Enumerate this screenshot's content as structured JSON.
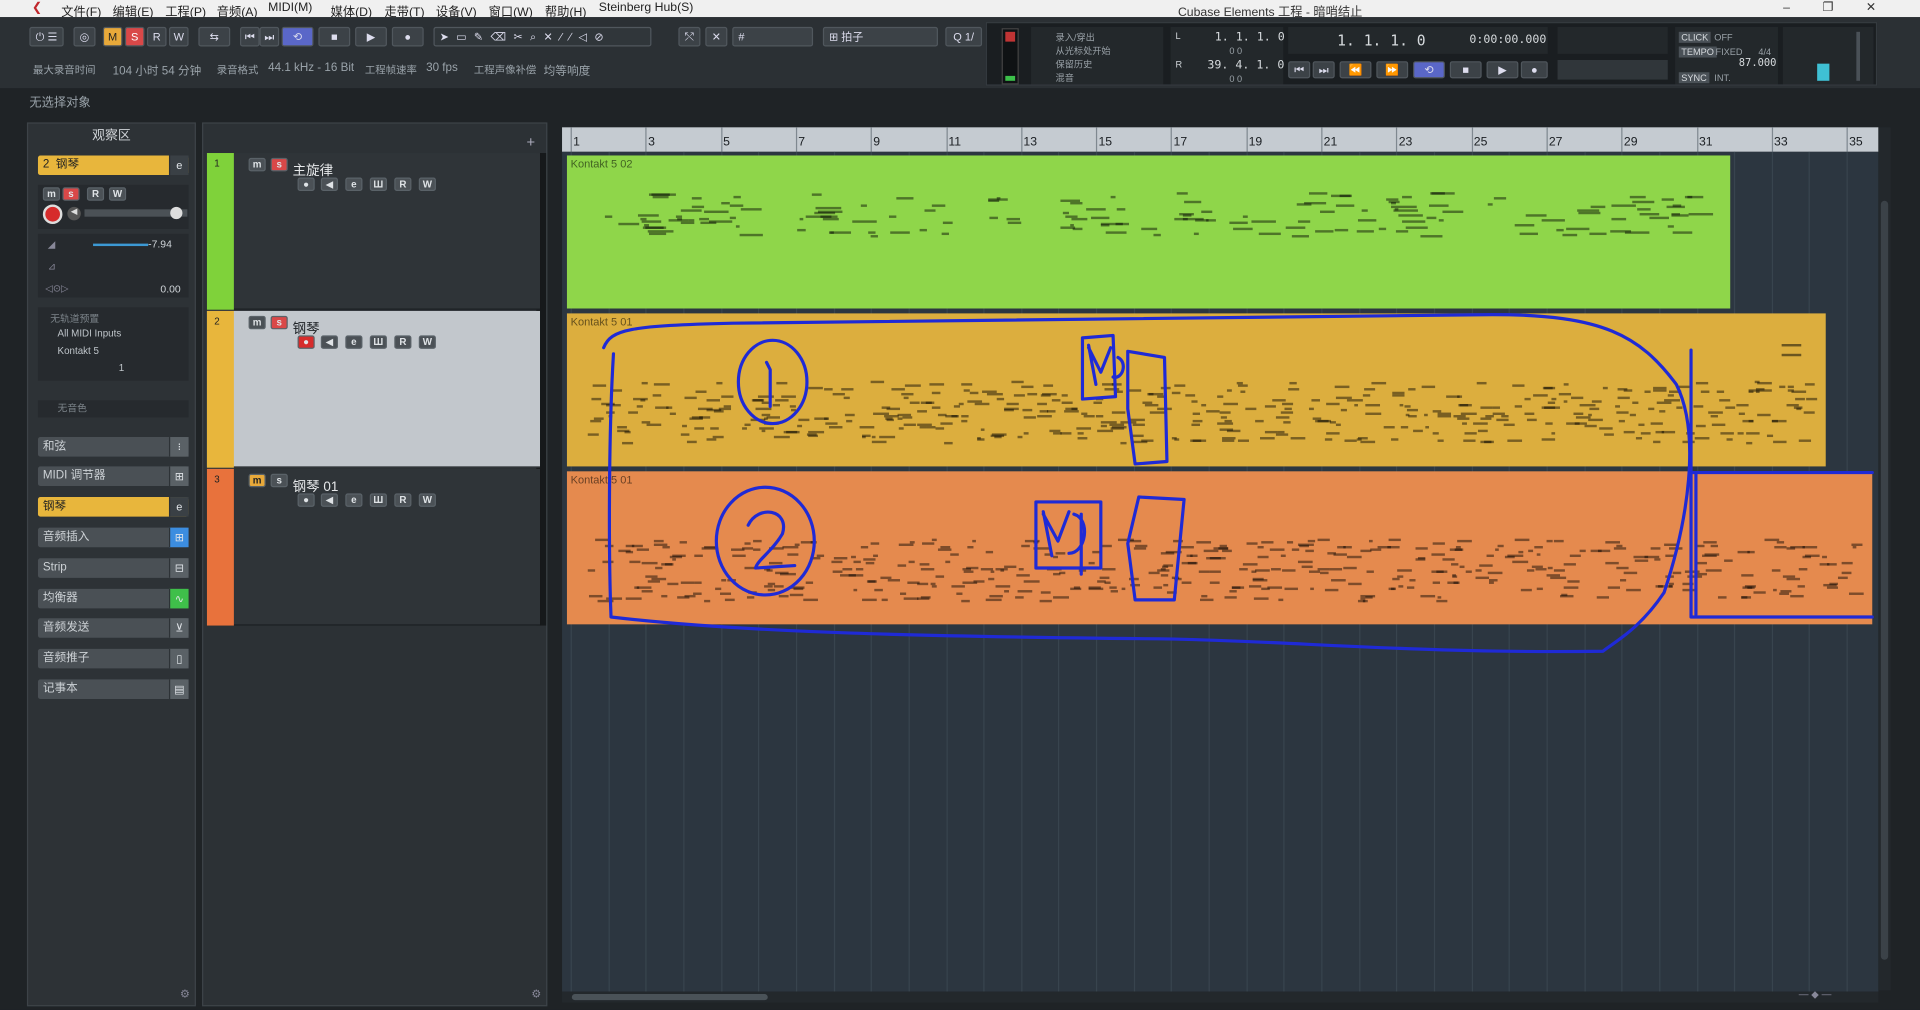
{
  "menu": {
    "items": [
      "文件(F)",
      "编辑(E)",
      "工程(P)",
      "音频(A)",
      "MIDI(M)",
      "媒体(D)",
      "走带(T)",
      "设备(V)",
      "窗口(W)",
      "帮助(H)",
      "Steinberg Hub(S)"
    ],
    "title": "Cubase Elements 工程 - 暗哨结止"
  },
  "toolbar": {
    "m_label": "M",
    "s_label": "S",
    "r_label": "R",
    "w_label": "W",
    "snap_type_label": "拍子",
    "info": {
      "max_record_label": "最大录音时间",
      "max_record_value": "104 小时 54 分钟",
      "format_label": "录音格式",
      "format_value": "44.1 kHz - 16 Bit",
      "fps_label": "工程帧速率",
      "fps_value": "30 fps",
      "pan_label": "工程声像补偿",
      "pan_value": "均等响度"
    }
  },
  "transport": {
    "history_items": [
      "录入/穿出",
      "从光标处开始",
      "保留历史",
      "混音"
    ],
    "left_locator": "1. 1. 1.   0",
    "left_locator_small": "0    0",
    "right_locator": "39. 4. 1.   0",
    "right_locator_small": "0    0",
    "position_bars": "1.  1.  1.    0",
    "position_time": "0:00:00.000",
    "click_label": "CLICK",
    "click_value": "OFF",
    "tempo_label": "TEMPO",
    "tempo_mode": "FIXED",
    "signature": "4/4",
    "tempo_value": "87.000",
    "sync_label": "SYNC",
    "sync_value": "INT."
  },
  "status": {
    "no_selection": "无选择对象"
  },
  "inspector": {
    "title": "观察区",
    "track_no": "2",
    "track_name": "钢琴",
    "volume_value": "-7.94",
    "pan_value": "0.00",
    "routing": [
      "无轨道预置",
      "All MIDI Inputs",
      "Kontakt 5"
    ],
    "channel": "1",
    "no_patch": "无音色",
    "sections": [
      "和弦",
      "MIDI 调节器",
      "钢琴",
      "音频插入",
      "Strip",
      "均衡器",
      "音频发送",
      "音频推子",
      "记事本"
    ]
  },
  "tracks": [
    {
      "no": "1",
      "name": "主旋律",
      "color": "#7fd23a",
      "part_name": "Kontakt 5 02",
      "part_color": "#8fd64a"
    },
    {
      "no": "2",
      "name": "钢琴",
      "color": "#e8b63c",
      "part_name": "Kontakt 5 01",
      "part_color": "#dcae3e"
    },
    {
      "no": "3",
      "name": "钢琴 01",
      "color": "#e8723c",
      "part_name": "Kontakt 5 01",
      "part_color": "#e58a4e"
    }
  ],
  "ruler": {
    "bars": [
      "1",
      "3",
      "5",
      "7",
      "9",
      "11",
      "13",
      "15",
      "17",
      "19",
      "21",
      "23",
      "25",
      "27",
      "29",
      "31",
      "33",
      "35"
    ]
  },
  "annotations": [
    "1",
    "2",
    "MD",
    "MD"
  ],
  "colors": {
    "annotation": "#1f2ad6",
    "melody": "#8fd64a",
    "piano": "#dcae3e",
    "piano01": "#e58a4e"
  }
}
